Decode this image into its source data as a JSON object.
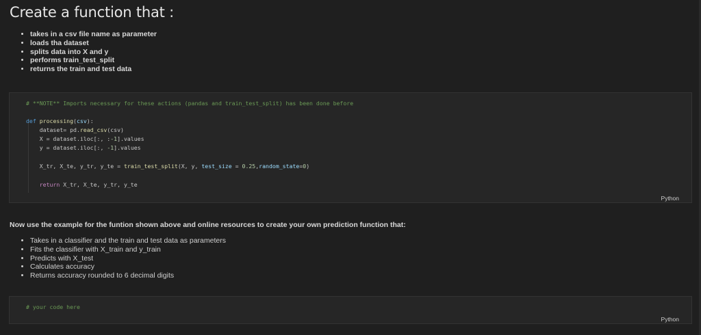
{
  "md1": {
    "title": "Create a function that :",
    "bullets": [
      "takes in a csv file name as parameter",
      "loads tha dataset",
      "splits data into X and y",
      "performs train_test_split",
      "returns the train and test data"
    ]
  },
  "code1": {
    "comment": "# **NOTE** Imports necessary for these actions (pandas and train_test_split) has been done before",
    "def_kw": "def",
    "func_name": "processing",
    "param": "csv",
    "line_dataset_a": "    dataset= pd.",
    "line_dataset_fn": "read_csv",
    "line_dataset_b": "(csv)",
    "line_x": "    X = dataset.iloc[:, :",
    "line_x_num": "-1",
    "line_x_end": "].values",
    "line_y": "    y = dataset.iloc[:, ",
    "line_y_num": "-1",
    "line_y_end": "].values",
    "line_split_a": "    X_tr, X_te, y_tr, y_te = ",
    "line_split_fn": "train_test_split",
    "line_split_b": "(X, y, ",
    "line_split_p1": "test_size",
    "line_split_c": " = ",
    "line_split_n1": "0.25",
    "line_split_d": ",",
    "line_split_p2": "random_state",
    "line_split_e": "=",
    "line_split_n2": "0",
    "line_split_f": ")",
    "return_kw": "return",
    "return_rest": " X_tr, X_te, y_tr, y_te",
    "lang": "Python"
  },
  "md2": {
    "paragraph": "Now use the example for the funtion shown above and online resources to create your own prediction function that:",
    "bullets": [
      "Takes in a classifier and the train and test data as parameters",
      "Fits the classifier with X_train and y_train",
      "Predicts with X_test",
      "Calculates accuracy",
      "Returns accuracy rounded to 6 decimal digits"
    ]
  },
  "code2": {
    "comment": "# your code here",
    "lang": "Python"
  }
}
